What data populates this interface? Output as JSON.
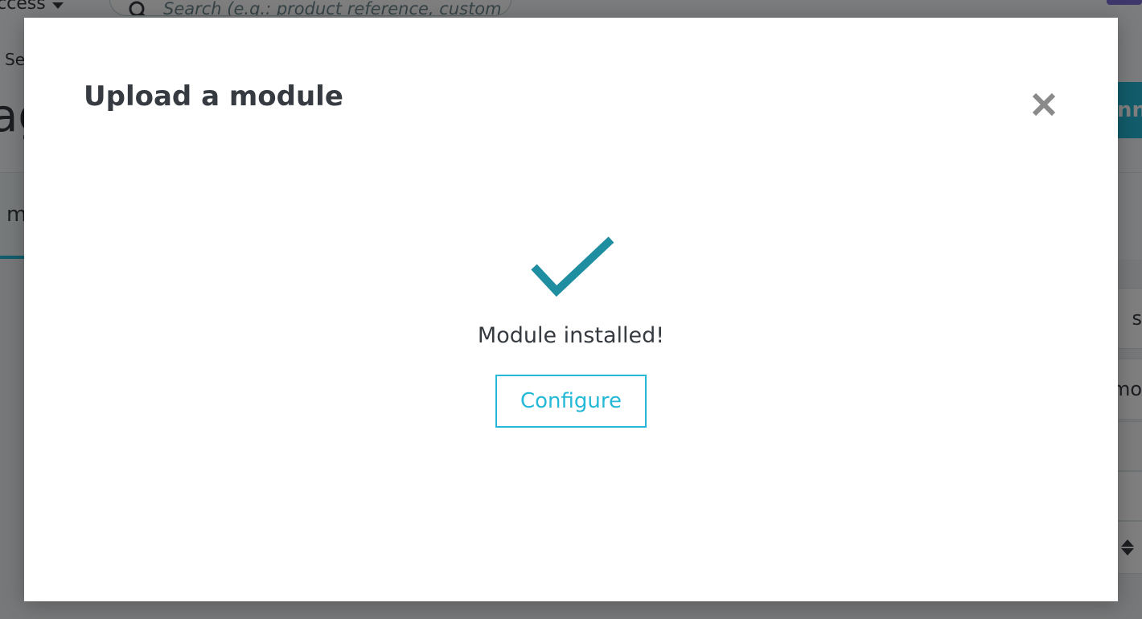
{
  "background": {
    "quick_access_label": "ccess",
    "search": {
      "placeholder": "Search (e.g.: product reference, custome"
    },
    "breadcrumb": "Se",
    "page_title": "ag",
    "tab_label": "m",
    "top_right_button_label": "nn",
    "right_cards": [
      "s",
      "mo",
      "",
      "",
      ""
    ]
  },
  "modal": {
    "title": "Upload a module",
    "success_message": "Module installed!",
    "configure_label": "Configure"
  },
  "colors": {
    "accent": "#25b9d7",
    "checkmark": "#1f8ea0",
    "text": "#363a41",
    "close": "#8a8a8a"
  },
  "icons": {
    "search": "search-icon",
    "close": "close-icon",
    "success": "checkmark-icon",
    "dropdown": "caret-down-icon",
    "sort": "sort-icon"
  }
}
